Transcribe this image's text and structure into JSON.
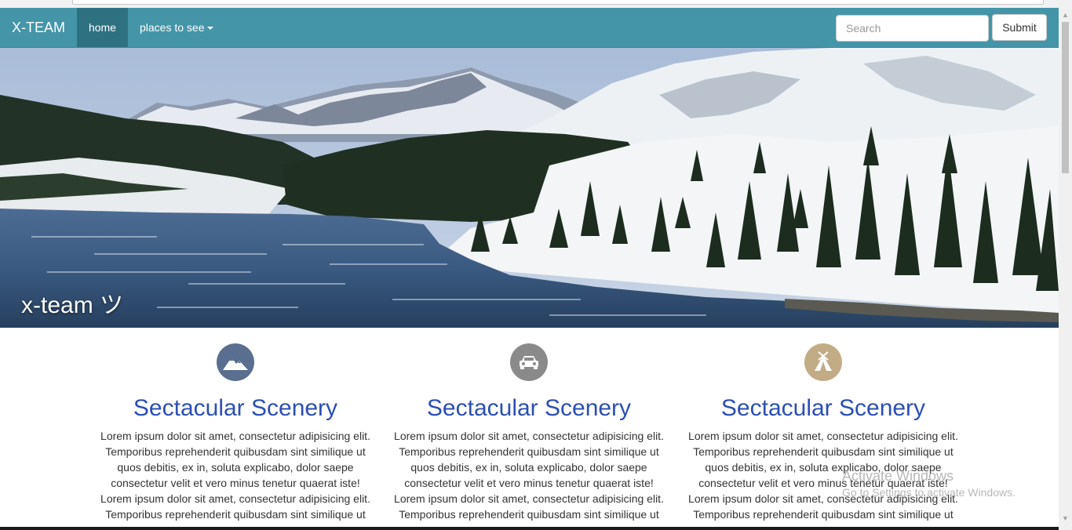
{
  "navbar": {
    "brand": "X-TEAM",
    "items": [
      {
        "label": "home",
        "active": true
      },
      {
        "label": "places to see",
        "dropdown": true
      }
    ],
    "search": {
      "placeholder": "Search",
      "value": ""
    },
    "submit_label": "Submit",
    "bg_color": "#4495a8",
    "active_color": "#2e7281"
  },
  "hero": {
    "caption": "x-team ツ"
  },
  "features": [
    {
      "icon": "mountain-icon",
      "icon_color": "#5a6e8f",
      "title": "Sectacular Scenery",
      "text": "Lorem ipsum dolor sit amet, consectetur adipisicing elit. Temporibus reprehenderit quibusdam sint similique ut quos debitis, ex in, soluta explicabo, dolor saepe consectetur velit et vero minus tenetur quaerat iste! Lorem ipsum dolor sit amet, consectetur adipisicing elit. Temporibus reprehenderit quibusdam sint similique ut"
    },
    {
      "icon": "car-icon",
      "icon_color": "#8a8a8a",
      "title": "Sectacular Scenery",
      "text": "Lorem ipsum dolor sit amet, consectetur adipisicing elit. Temporibus reprehenderit quibusdam sint similique ut quos debitis, ex in, soluta explicabo, dolor saepe consectetur velit et vero minus tenetur quaerat iste! Lorem ipsum dolor sit amet, consectetur adipisicing elit. Temporibus reprehenderit quibusdam sint similique ut"
    },
    {
      "icon": "tent-icon",
      "icon_color": "#c2ac86",
      "title": "Sectacular Scenery",
      "text": "Lorem ipsum dolor sit amet, consectetur adipisicing elit. Temporibus reprehenderit quibusdam sint similique ut quos debitis, ex in, soluta explicabo, dolor saepe consectetur velit et vero minus tenetur quaerat iste! Lorem ipsum dolor sit amet, consectetur adipisicing elit. Temporibus reprehenderit quibusdam sint similique ut"
    }
  ],
  "watermark": {
    "line1": "Activate Windows",
    "line2": "Go to Settings to activate Windows."
  }
}
